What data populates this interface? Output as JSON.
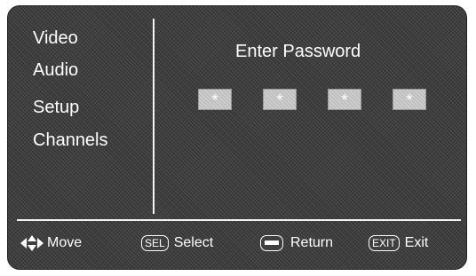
{
  "menu": {
    "items": [
      {
        "label": "Video"
      },
      {
        "label": "Audio"
      },
      {
        "label": "Setup"
      },
      {
        "label": "Channels"
      }
    ]
  },
  "password": {
    "title": "Enter Password",
    "digits": [
      "*",
      "*",
      "*",
      "*"
    ]
  },
  "footer": {
    "move": {
      "icon": "dpad-arrows-icon",
      "label": "Move"
    },
    "select": {
      "key": "SEL",
      "label": "Select"
    },
    "return": {
      "icon": "minus-key-icon",
      "label": "Return"
    },
    "exit": {
      "key": "EXIT",
      "label": "Exit"
    }
  },
  "colors": {
    "background": "#3c3c3c",
    "text": "#ffffff",
    "password_box": "#cfcfcf"
  }
}
